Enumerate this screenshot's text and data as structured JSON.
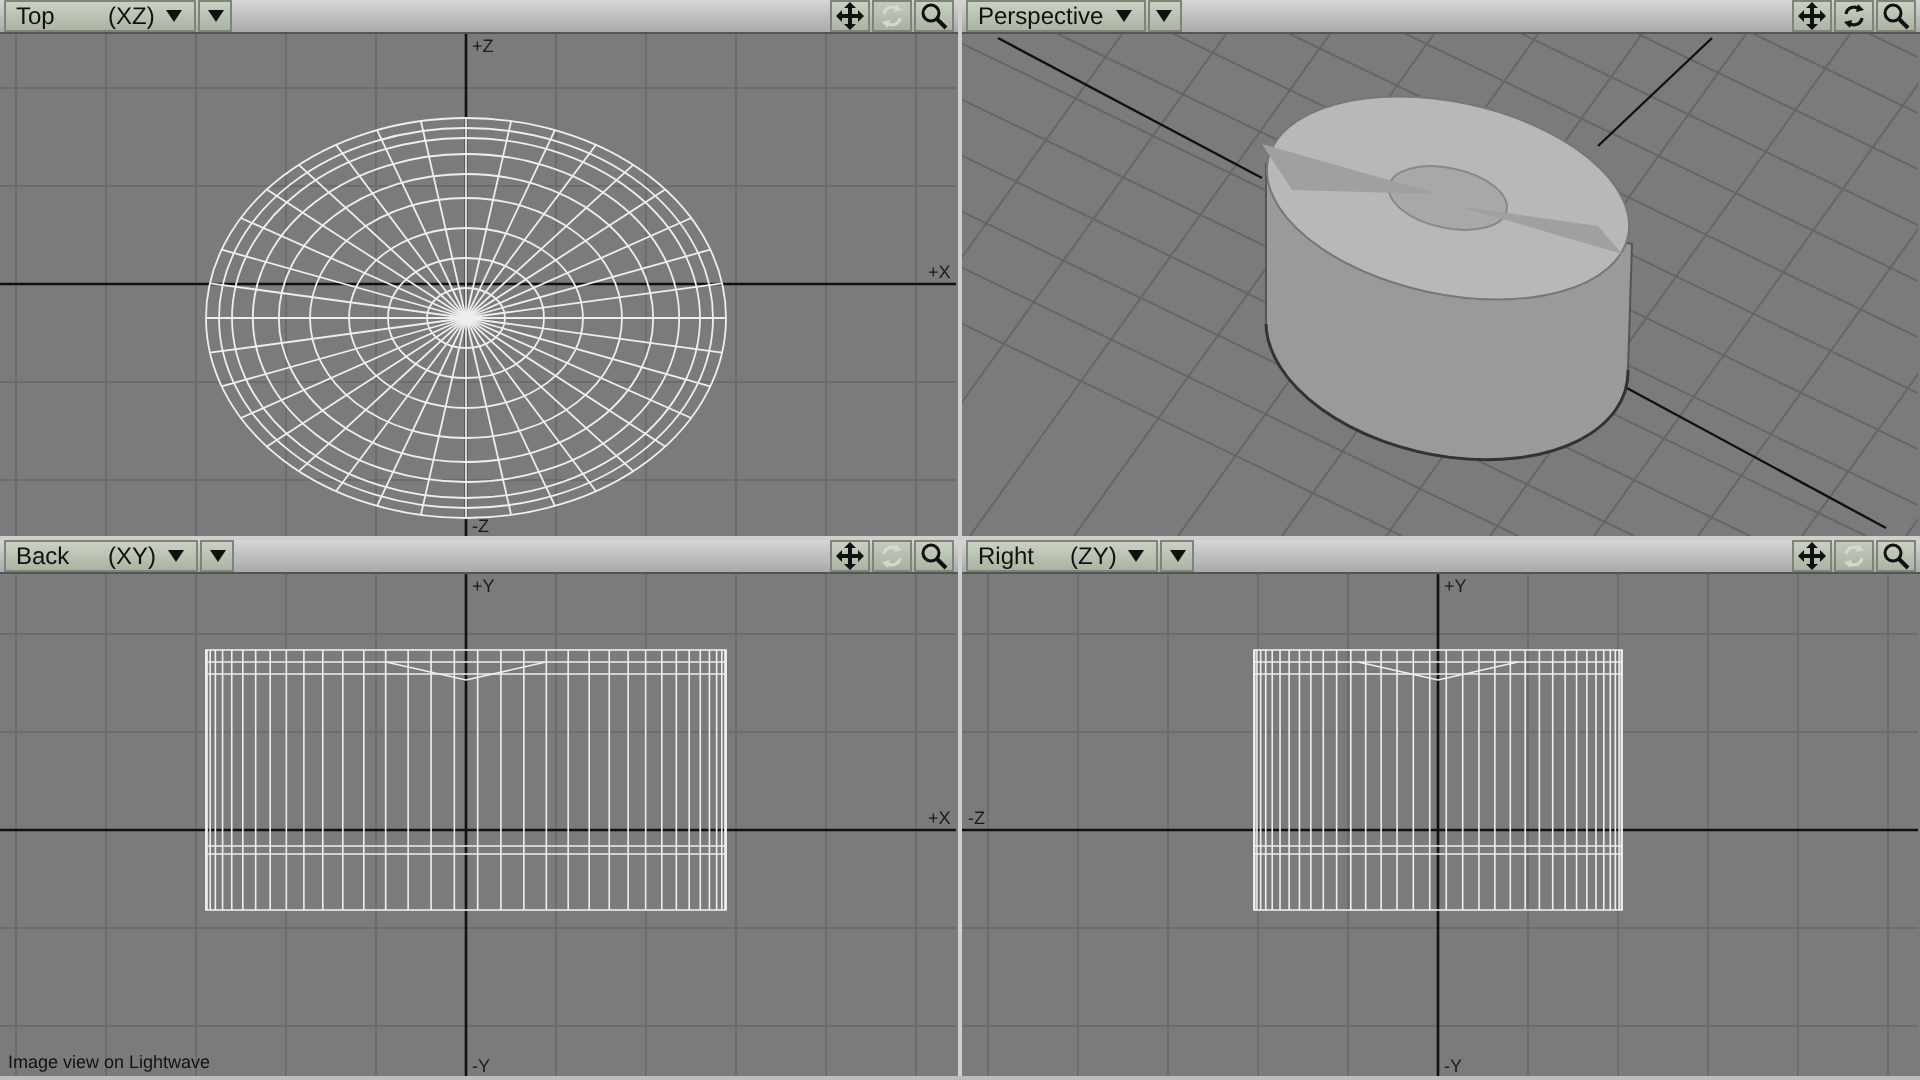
{
  "viewports": [
    {
      "kind": "top",
      "title": "Top",
      "axes": "(XZ)",
      "rotate_enabled": false,
      "axis_labels": {
        "top": "+Z",
        "right": "+X",
        "bottom": "-Z"
      }
    },
    {
      "kind": "perspective",
      "title": "Perspective",
      "rotate_enabled": true
    },
    {
      "kind": "back",
      "title": "Back",
      "axes": "(XY)",
      "rotate_enabled": false,
      "axis_labels": {
        "top": "+Y",
        "right": "+X",
        "bottom": "-Y"
      }
    },
    {
      "kind": "right",
      "title": "Right",
      "axes": "(ZY)",
      "rotate_enabled": false,
      "axis_labels": {
        "top": "+Y",
        "left": "-Z",
        "bottom": "-Y"
      }
    }
  ],
  "caption": "Image view on Lightwave"
}
